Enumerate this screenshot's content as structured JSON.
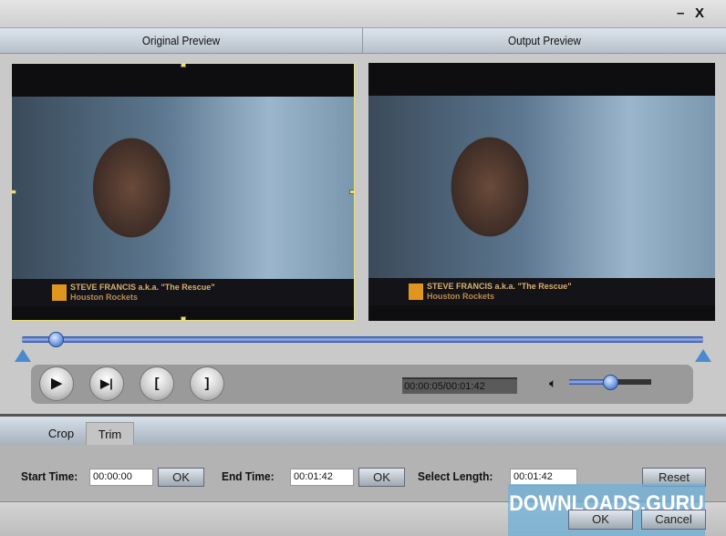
{
  "window": {
    "minimize": "–",
    "close": "X"
  },
  "header": {
    "original": "Original Preview",
    "output": "Output Preview"
  },
  "video": {
    "caption_line1": "STEVE FRANCIS a.k.a. \"The Rescue\"",
    "caption_line2": "Houston Rockets"
  },
  "playback": {
    "time": "00:00:05/00:01:42",
    "position_fraction": 0.05,
    "volume_fraction": 0.5,
    "buttons": [
      {
        "icon": "play-icon",
        "glyph": "▶"
      },
      {
        "icon": "step-frame-icon",
        "glyph": "▶|"
      },
      {
        "icon": "mark-in-icon",
        "glyph": "["
      },
      {
        "icon": "mark-out-icon",
        "glyph": "]"
      }
    ]
  },
  "tabs": [
    {
      "label": "Crop"
    },
    {
      "label": "Trim"
    }
  ],
  "trim": {
    "start_label": "Start Time:",
    "start_value": "00:00:00",
    "ok1": "OK",
    "end_label": "End Time:",
    "end_value": "00:01:42",
    "ok2": "OK",
    "length_label": "Select Length:",
    "length_value": "00:01:42",
    "reset": "Reset"
  },
  "footer": {
    "ok": "OK",
    "cancel": "Cancel"
  },
  "watermark": "DOWNLOADS.GURU"
}
